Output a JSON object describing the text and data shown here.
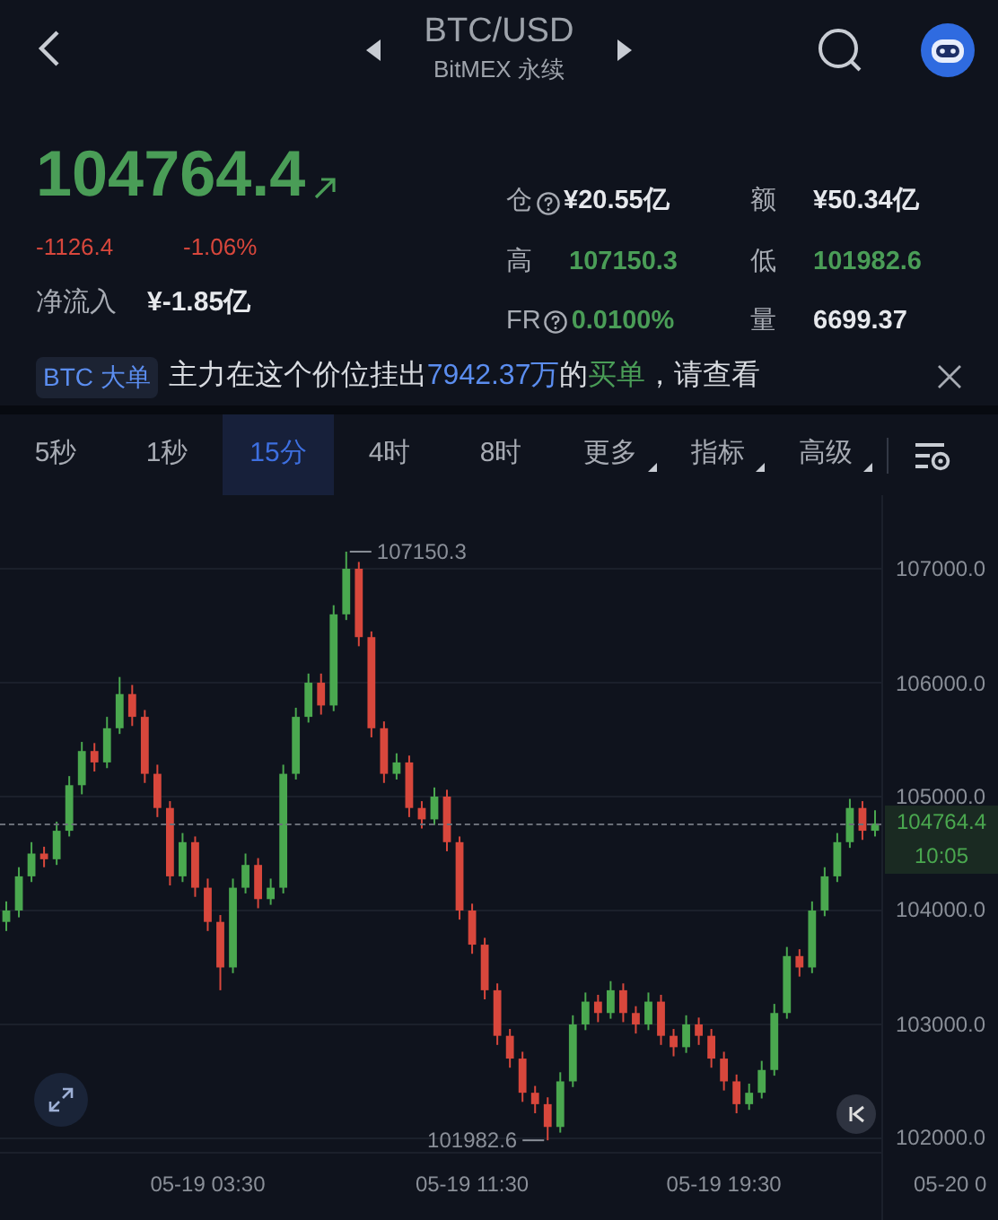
{
  "header": {
    "title": "BTC/USD",
    "subtitle": "BitMEX 永续"
  },
  "quote": {
    "price": "104764.4",
    "change": "-1126.4",
    "change_pct": "-1.06%",
    "inflow_label": "净流入",
    "inflow": "¥-1.85亿"
  },
  "stats": [
    {
      "label": "仓",
      "help": true,
      "value": "¥20.55亿",
      "color": "#e6e8ec"
    },
    {
      "label": "额",
      "help": false,
      "value": "¥50.34亿",
      "color": "#e6e8ec"
    },
    {
      "label": "高",
      "help": false,
      "value": "107150.3",
      "color": "#4a9d57"
    },
    {
      "label": "低",
      "help": false,
      "value": "101982.6",
      "color": "#4a9d57"
    },
    {
      "label": "FR",
      "help": true,
      "value": "0.0100%",
      "color": "#4a9d57"
    },
    {
      "label": "量",
      "help": false,
      "value": "6699.37",
      "color": "#e6e8ec"
    }
  ],
  "banner": {
    "tag": "BTC 大单",
    "segments": [
      {
        "text": "主力在这个价位挂出",
        "color": "#d8dbe0"
      },
      {
        "text": "7942.37万",
        "color": "#5b8def"
      },
      {
        "text": "的",
        "color": "#d8dbe0"
      },
      {
        "text": "买单",
        "color": "#4a9d57"
      },
      {
        "text": "，请查看",
        "color": "#d8dbe0"
      }
    ]
  },
  "tabs": [
    {
      "label": "5秒",
      "selected": false,
      "dropdown": false
    },
    {
      "label": "1秒",
      "selected": false,
      "dropdown": false
    },
    {
      "label": "15分",
      "selected": true,
      "dropdown": false
    },
    {
      "label": "4时",
      "selected": false,
      "dropdown": false
    },
    {
      "label": "8时",
      "selected": false,
      "dropdown": false
    },
    {
      "label": "更多",
      "selected": false,
      "dropdown": true
    },
    {
      "label": "指标",
      "selected": false,
      "dropdown": true
    },
    {
      "label": "高级",
      "selected": false,
      "dropdown": true
    }
  ],
  "chart": {
    "high_label": "107150.3",
    "low_label": "101982.6",
    "last_price": "104764.4",
    "countdown": "10:05",
    "edge_time_label": "05-20 0",
    "chart_data": {
      "type": "candlestick",
      "ylim": [
        101283,
        107646
      ],
      "grid": true,
      "yticks": [
        {
          "value": 107000,
          "label": "107000.0"
        },
        {
          "value": 106000,
          "label": "106000.0"
        },
        {
          "value": 105000,
          "label": "105000.0"
        },
        {
          "value": 104000,
          "label": "104000.0"
        },
        {
          "value": 103000,
          "label": "103000.0"
        },
        {
          "value": 102000,
          "label": "102000.0"
        }
      ],
      "categories": [
        null,
        null,
        null,
        null,
        null,
        null,
        null,
        null,
        null,
        null,
        null,
        null,
        null,
        null,
        null,
        null,
        "05-19 03:30",
        null,
        null,
        null,
        null,
        null,
        null,
        null,
        null,
        null,
        null,
        null,
        null,
        null,
        null,
        null,
        null,
        null,
        null,
        null,
        null,
        "05-19 11:30",
        null,
        null,
        null,
        null,
        null,
        null,
        null,
        null,
        null,
        null,
        null,
        null,
        null,
        null,
        null,
        null,
        null,
        null,
        null,
        "05-19 19:30",
        null,
        null,
        null,
        null,
        null,
        null,
        null,
        null,
        null,
        null,
        null,
        null
      ],
      "ohlc": [
        [
          103900,
          104080,
          103820,
          104000
        ],
        [
          104000,
          104380,
          103940,
          104300
        ],
        [
          104300,
          104600,
          104250,
          104500
        ],
        [
          104500,
          104560,
          104380,
          104450
        ],
        [
          104450,
          104780,
          104400,
          104700
        ],
        [
          104700,
          105180,
          104650,
          105100
        ],
        [
          105100,
          105480,
          105020,
          105400
        ],
        [
          105400,
          105470,
          105220,
          105300
        ],
        [
          105300,
          105700,
          105250,
          105600
        ],
        [
          105600,
          106050,
          105550,
          105900
        ],
        [
          105900,
          105980,
          105620,
          105700
        ],
        [
          105700,
          105760,
          105120,
          105200
        ],
        [
          105200,
          105280,
          104820,
          104900
        ],
        [
          104900,
          104960,
          104220,
          104300
        ],
        [
          104300,
          104680,
          104250,
          104600
        ],
        [
          104600,
          104650,
          104120,
          104200
        ],
        [
          104200,
          104280,
          103820,
          103900
        ],
        [
          103900,
          103960,
          103300,
          103500
        ],
        [
          103500,
          104280,
          103450,
          104200
        ],
        [
          104200,
          104500,
          104150,
          104400
        ],
        [
          104400,
          104460,
          104020,
          104100
        ],
        [
          104100,
          104280,
          104050,
          104200
        ],
        [
          104200,
          105280,
          104150,
          105200
        ],
        [
          105200,
          105780,
          105150,
          105700
        ],
        [
          105700,
          106080,
          105650,
          106000
        ],
        [
          106000,
          106080,
          105720,
          105800
        ],
        [
          105800,
          106680,
          105750,
          106600
        ],
        [
          106600,
          107150.3,
          106550,
          107000
        ],
        [
          107000,
          107060,
          106320,
          106400
        ],
        [
          106400,
          106450,
          105520,
          105600
        ],
        [
          105600,
          105660,
          105120,
          105200
        ],
        [
          105200,
          105380,
          105150,
          105300
        ],
        [
          105300,
          105360,
          104820,
          104900
        ],
        [
          104900,
          104960,
          104720,
          104800
        ],
        [
          104800,
          105080,
          104750,
          105000
        ],
        [
          105000,
          105060,
          104520,
          104600
        ],
        [
          104600,
          104650,
          103920,
          104000
        ],
        [
          104000,
          104060,
          103620,
          103700
        ],
        [
          103700,
          103760,
          103220,
          103300
        ],
        [
          103300,
          103360,
          102820,
          102900
        ],
        [
          102900,
          102960,
          102620,
          102700
        ],
        [
          102700,
          102760,
          102320,
          102400
        ],
        [
          102400,
          102460,
          102220,
          102300
        ],
        [
          102300,
          102360,
          101982.6,
          102100
        ],
        [
          102100,
          102580,
          102050,
          102500
        ],
        [
          102500,
          103080,
          102450,
          103000
        ],
        [
          103000,
          103280,
          102950,
          103200
        ],
        [
          103200,
          103260,
          103020,
          103100
        ],
        [
          103100,
          103380,
          103050,
          103300
        ],
        [
          103300,
          103360,
          103020,
          103100
        ],
        [
          103100,
          103160,
          102920,
          103000
        ],
        [
          103000,
          103280,
          102950,
          103200
        ],
        [
          103200,
          103260,
          102820,
          102900
        ],
        [
          102900,
          102960,
          102720,
          102800
        ],
        [
          102800,
          103080,
          102750,
          103000
        ],
        [
          103000,
          103060,
          102820,
          102900
        ],
        [
          102900,
          102960,
          102620,
          102700
        ],
        [
          102700,
          102760,
          102420,
          102500
        ],
        [
          102500,
          102560,
          102220,
          102300
        ],
        [
          102300,
          102480,
          102250,
          102400
        ],
        [
          102400,
          102680,
          102350,
          102600
        ],
        [
          102600,
          103180,
          102550,
          103100
        ],
        [
          103100,
          103680,
          103050,
          103600
        ],
        [
          103600,
          103660,
          103420,
          103500
        ],
        [
          103500,
          104080,
          103450,
          104000
        ],
        [
          104000,
          104380,
          103950,
          104300
        ],
        [
          104300,
          104680,
          104250,
          104600
        ],
        [
          104600,
          104980,
          104550,
          104900
        ],
        [
          104900,
          104960,
          104620,
          104700
        ],
        [
          104700,
          104880,
          104650,
          104764.4
        ]
      ]
    }
  }
}
